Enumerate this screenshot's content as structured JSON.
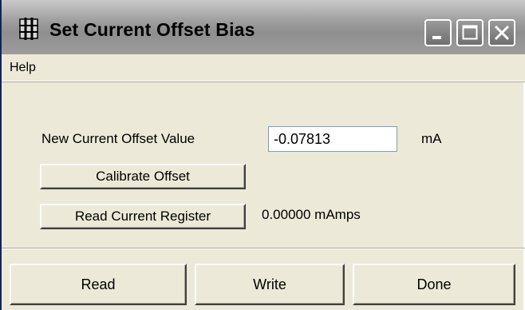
{
  "window": {
    "title": "Set Current Offset Bias",
    "app_icon": "grid-app-icon",
    "caption_buttons": [
      "minimize-icon",
      "maximize-icon",
      "close-icon"
    ]
  },
  "menu": {
    "items": [
      "Help"
    ]
  },
  "form": {
    "offset_label": "New Current Offset Value",
    "offset_value": "-0.07813",
    "offset_unit": "mA",
    "calibrate_label": "Calibrate Offset",
    "read_register_label": "Read Current Register",
    "register_reading": "0.00000 mAmps"
  },
  "footer": {
    "read_label": "Read",
    "write_label": "Write",
    "done_label": "Done"
  },
  "colors": {
    "window_bg": "#ece9d8",
    "titlebar": "#9d9d9d",
    "input_border": "#7f9db9"
  }
}
